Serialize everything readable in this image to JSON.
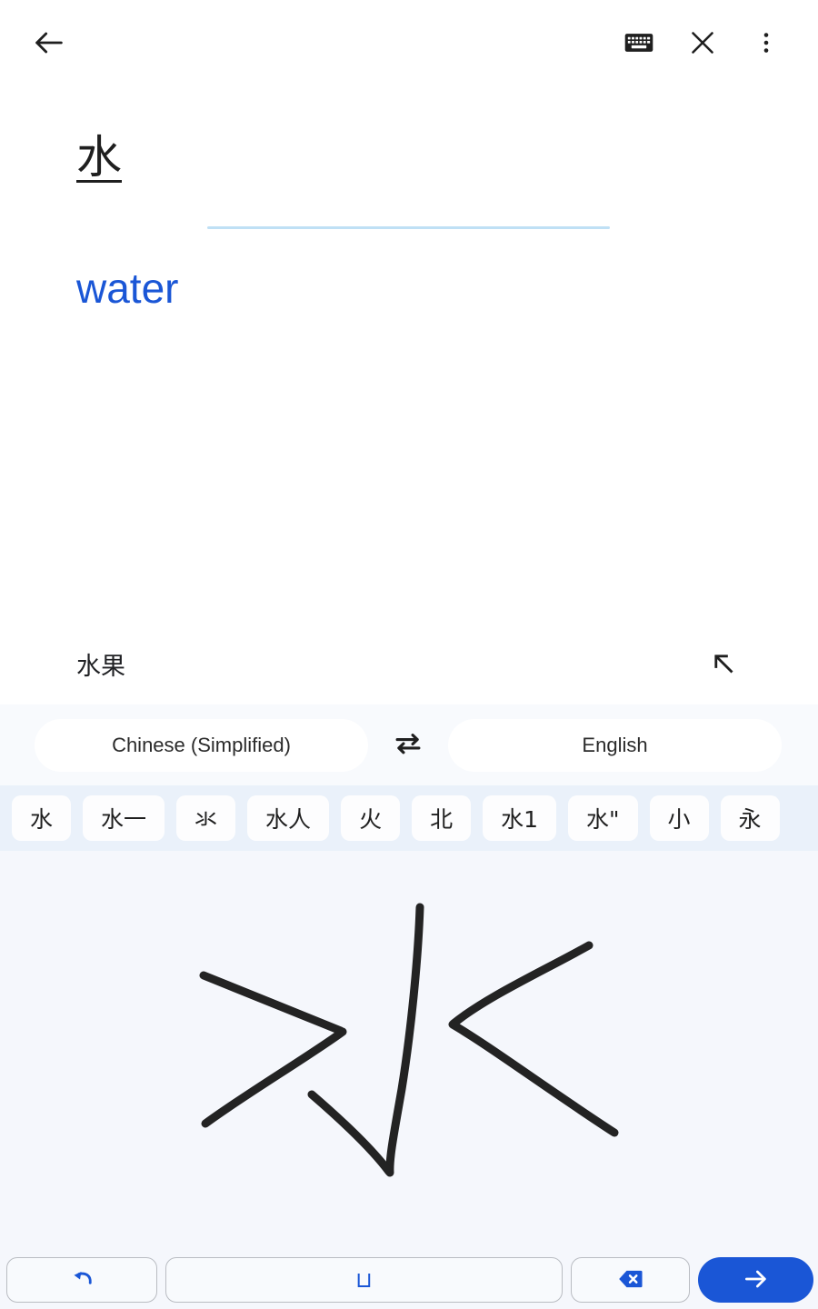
{
  "appbar": {
    "back_icon": "back-arrow-icon",
    "keyboard_icon": "keyboard-icon",
    "close_icon": "close-icon",
    "overflow_icon": "more-vert-icon"
  },
  "translation": {
    "source_text": "水",
    "target_text": "water",
    "suggestion": "水果",
    "suggestion_icon": "arrow-northwest-icon",
    "divider_color": "#bfe0f5",
    "target_color": "#1a56d6"
  },
  "language_bar": {
    "source_language": "Chinese (Simplified)",
    "target_language": "English",
    "swap_icon": "swap-horizontal-icon"
  },
  "candidates": [
    {
      "label": "水"
    },
    {
      "label": "水一"
    },
    {
      "label": "氺"
    },
    {
      "label": "水人"
    },
    {
      "label": "火"
    },
    {
      "label": "北"
    },
    {
      "label": "水1"
    },
    {
      "label": "水\""
    },
    {
      "label": "小"
    },
    {
      "label": "永"
    }
  ],
  "handwriting": {
    "ink_color": "#232323",
    "canvas_color": "#f5f7fc",
    "stroke_count": 4
  },
  "bottom_bar": {
    "undo_icon": "undo-icon",
    "space_label": "⊔",
    "backspace_icon": "backspace-icon",
    "submit_icon": "arrow-right-icon",
    "accent_color": "#1a56d6"
  }
}
